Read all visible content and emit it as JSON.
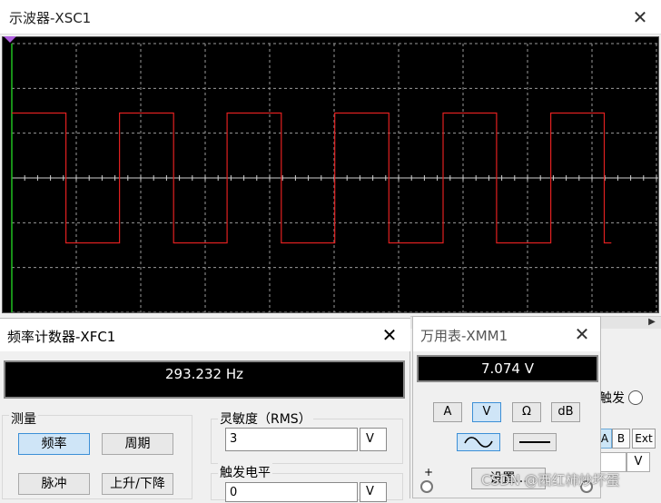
{
  "oscilloscope": {
    "title": "示波器-XSC1",
    "close_glyph": "✕",
    "trigger_label": "触发",
    "channel_buttons": [
      "A",
      "B",
      "Ext"
    ],
    "level_unit": "V",
    "trace_color": "#e02020",
    "screen_color": "#000000"
  },
  "chart_data": {
    "type": "line",
    "title": "",
    "xlabel": "",
    "ylabel": "",
    "grid": true,
    "grid_divisions": {
      "x": 10,
      "y": 6
    },
    "series": [
      {
        "color": "#e02020",
        "x": [
          0,
          0.84,
          0.84,
          1.67,
          1.67,
          2.51,
          2.51,
          3.34,
          3.34,
          4.18,
          4.18,
          5.01,
          5.01,
          5.85,
          5.85,
          6.69,
          6.69,
          7.52,
          7.52,
          8.36,
          8.36,
          9.19,
          9.19,
          9.3
        ],
        "y": [
          1.45,
          1.45,
          -1.45,
          -1.45,
          1.45,
          1.45,
          -1.45,
          -1.45,
          1.45,
          1.45,
          -1.45,
          -1.45,
          1.45,
          1.45,
          -1.45,
          -1.45,
          1.45,
          1.45,
          -1.45,
          -1.45,
          1.45,
          1.45,
          -1.45,
          -1.45
        ]
      }
    ],
    "xlim": [
      0,
      10
    ],
    "ylim": [
      -3,
      3
    ]
  },
  "counter": {
    "title": "频率计数器-XFC1",
    "close_glyph": "✕",
    "reading": "293.232 Hz",
    "measure_label": "测量",
    "buttons": {
      "frequency": "频率",
      "period": "周期",
      "pulse": "脉冲",
      "rise_fall": "上升/下降"
    },
    "sensitivity_label": "灵敏度（RMS）",
    "sensitivity_value": "3",
    "sensitivity_unit": "V",
    "trigger_level_label": "触发电平",
    "trigger_level_value": "0",
    "trigger_level_unit": "V",
    "selected_color": "#cfe5f7"
  },
  "multimeter": {
    "title": "万用表-XMM1",
    "close_glyph": "✕",
    "reading": "7.074 V",
    "modes": [
      "A",
      "V",
      "Ω",
      "dB"
    ],
    "selected_mode": "V",
    "settings_label": "设置...",
    "plus_label": "+"
  },
  "watermark": "CSDN @西红柿炒坏蛋"
}
